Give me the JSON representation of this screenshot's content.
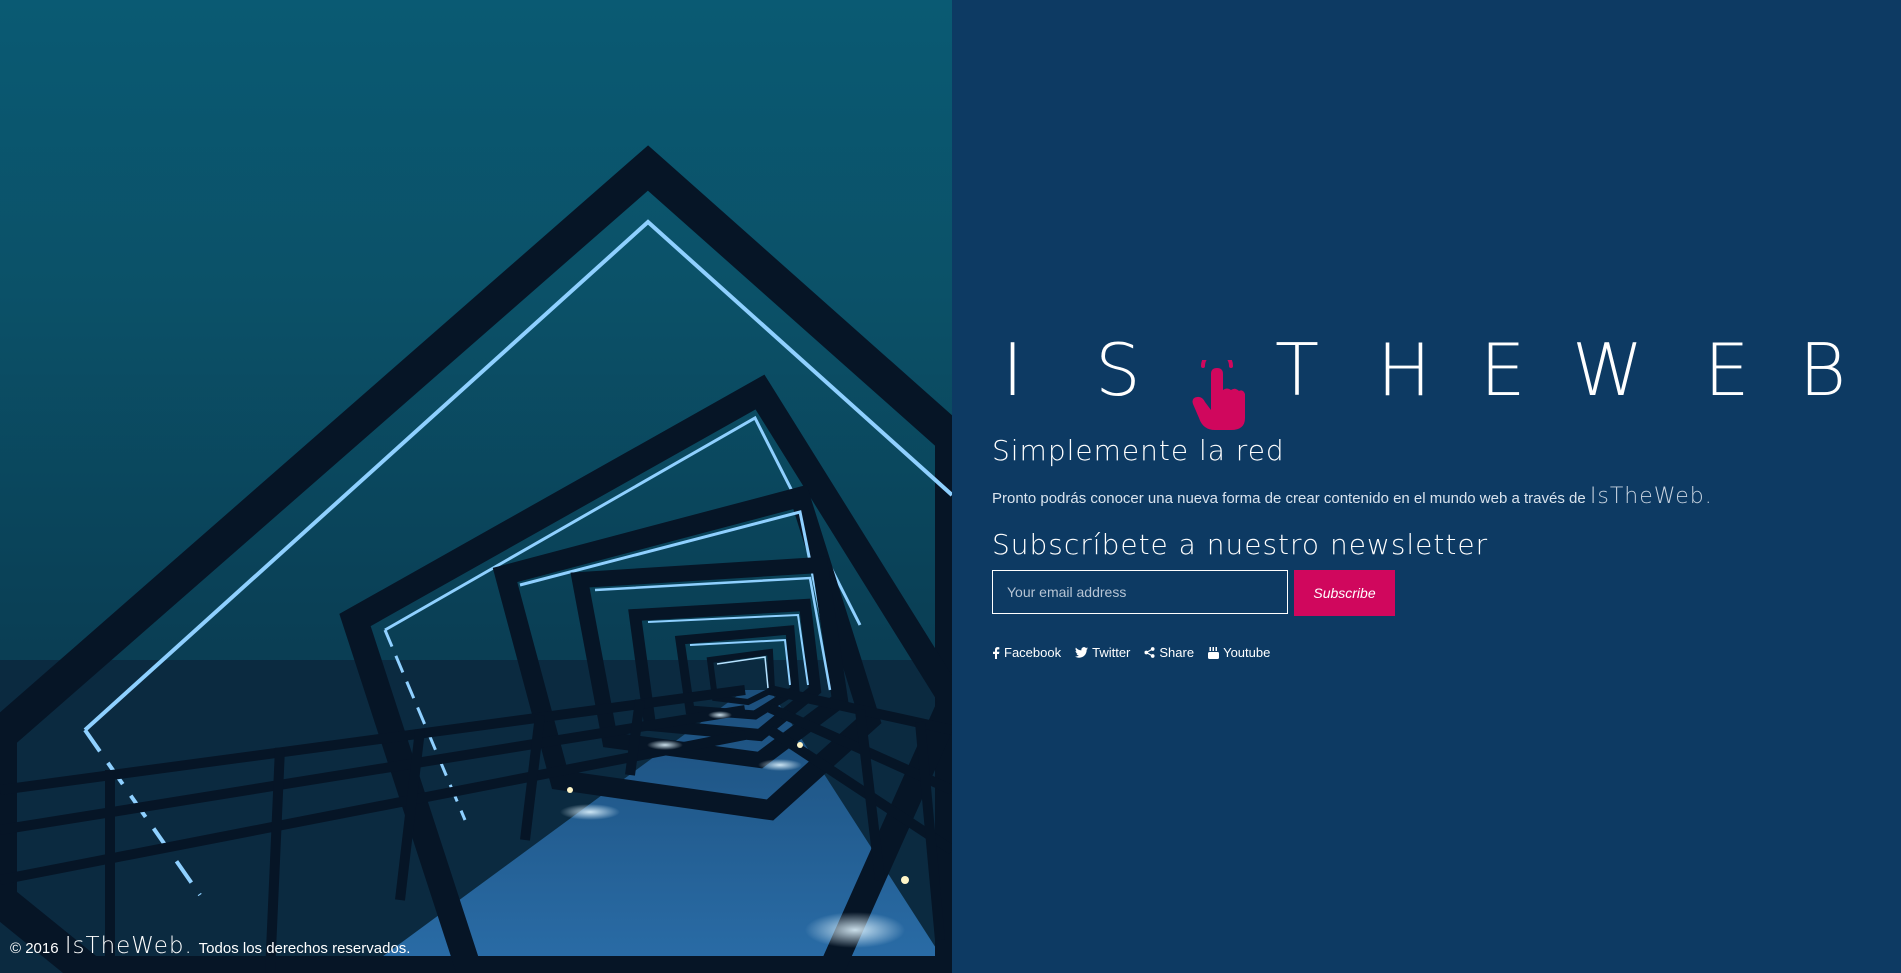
{
  "brand": {
    "logo_letters": [
      "I",
      "S",
      "T",
      "H",
      "E",
      "W",
      "E",
      "B"
    ],
    "name": "IsTheWeb.",
    "accent_color": "#d0075d",
    "background_color": "#0d3a63",
    "logo_icon": "pointing-hand-icon"
  },
  "hero": {
    "image_subject": "bridge-photo"
  },
  "main": {
    "tagline": "Simplemente la red",
    "description_text": "Pronto podrás conocer una nueva forma de crear contenido en el mundo web a través de",
    "description_brand": "IsTheWeb.",
    "newsletter_title": "Subscríbete a nuestro newsletter"
  },
  "form": {
    "email_placeholder": "Your email address",
    "subscribe_label": "Subscribe"
  },
  "social": [
    {
      "label": "Facebook",
      "icon": "facebook-icon"
    },
    {
      "label": "Twitter",
      "icon": "twitter-icon"
    },
    {
      "label": "Share",
      "icon": "share-icon"
    },
    {
      "label": "Youtube",
      "icon": "youtube-icon"
    }
  ],
  "footer": {
    "copyright_prefix": "© 2016",
    "copyright_brand": "IsTheWeb.",
    "copyright_suffix": "Todos los derechos reservados."
  }
}
